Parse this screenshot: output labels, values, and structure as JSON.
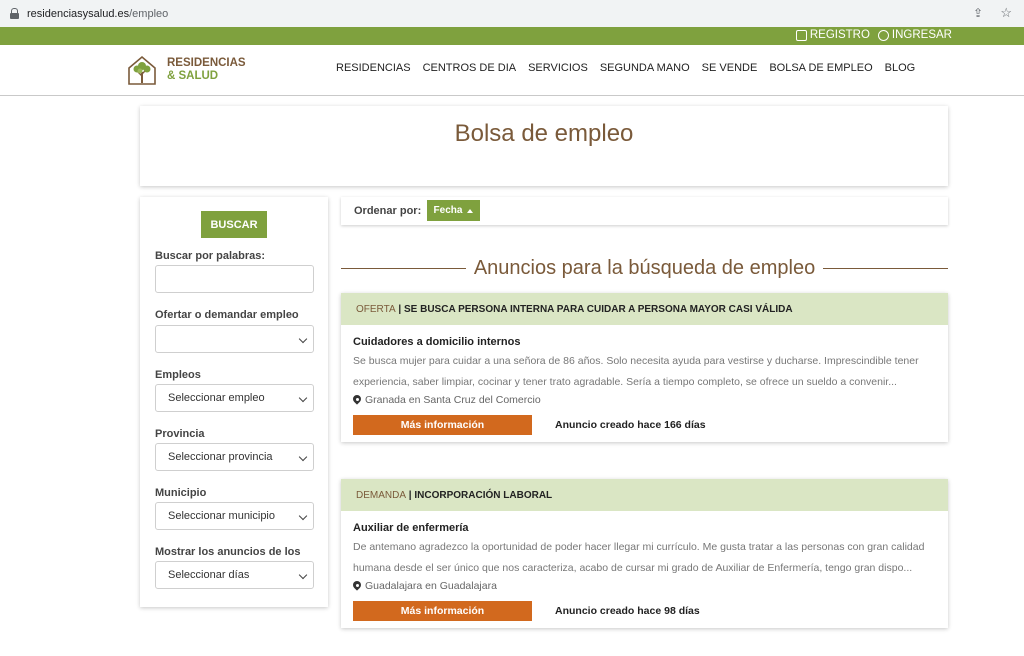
{
  "browser": {
    "url_host": "residenciasysalud.es",
    "url_path": "/empleo"
  },
  "topbar": {
    "registro": "REGISTRO",
    "ingresar": "INGRESAR"
  },
  "logo": {
    "line1": "RESIDENCIAS",
    "line2": "& SALUD"
  },
  "nav": {
    "items": [
      {
        "label": "RESIDENCIAS"
      },
      {
        "label": "CENTROS DE DIA"
      },
      {
        "label": "SERVICIOS"
      },
      {
        "label": "SEGUNDA MANO"
      },
      {
        "label": "SE VENDE"
      },
      {
        "label": "BOLSA DE EMPLEO"
      },
      {
        "label": "BLOG"
      }
    ],
    "active": "BOLSA DE EMPLEO",
    "highlight_color": "#e0141e"
  },
  "page": {
    "title": "Bolsa de empleo"
  },
  "sidebar": {
    "search_button": "BUSCAR",
    "keywords_label": "Buscar por palabras:",
    "keywords_value": "",
    "offer_label": "Ofertar o demandar empleo",
    "offer_value": "",
    "jobs_label": "Empleos",
    "jobs_value": "Seleccionar empleo",
    "province_label": "Provincia",
    "province_value": "Seleccionar provincia",
    "municipality_label": "Municipio",
    "municipality_value": "Seleccionar municipio",
    "days_label": "Mostrar los anuncios de los",
    "days_value": "Seleccionar días"
  },
  "sort": {
    "label": "Ordenar por:",
    "button": "Fecha"
  },
  "section_title": "Anuncios para la búsqueda de empleo",
  "listings": [
    {
      "type": "OFERTA",
      "separator": " | ",
      "headline": "SE BUSCA PERSONA INTERNA PARA CUIDAR A PERSONA MAYOR CASI VÁLIDA",
      "title": "Cuidadores a domicilio internos",
      "description": "Se busca mujer para cuidar a una señora de 86 años. Solo necesita ayuda para vestirse y ducharse. Imprescindible tener experiencia, saber limpiar, cocinar y tener trato agradable. Sería a tiempo completo, se ofrece un sueldo a convenir...",
      "location": "Granada en Santa Cruz del Comercio",
      "more_button": "Más información",
      "created": "Anuncio creado hace 166 días"
    },
    {
      "type": "DEMANDA",
      "separator": " | ",
      "headline": "INCORPORACIÓN LABORAL",
      "title": "Auxiliar de enfermería",
      "description": "De antemano agradezco la oportunidad de poder hacer llegar mi currículo. Me gusta tratar a las personas con gran calidad humana desde el ser único que nos caracteriza, acabo de cursar mi grado de Auxiliar de Enfermería, tengo gran dispo...",
      "location": "Guadalajara en Guadalajara",
      "more_button": "Más información",
      "created": "Anuncio creado hace 98 días"
    }
  ],
  "colors": {
    "brand_green": "#7fa13e",
    "brand_brown": "#7a5a3a",
    "cta_orange": "#d2691e",
    "listing_bar": "#dae6c4"
  }
}
